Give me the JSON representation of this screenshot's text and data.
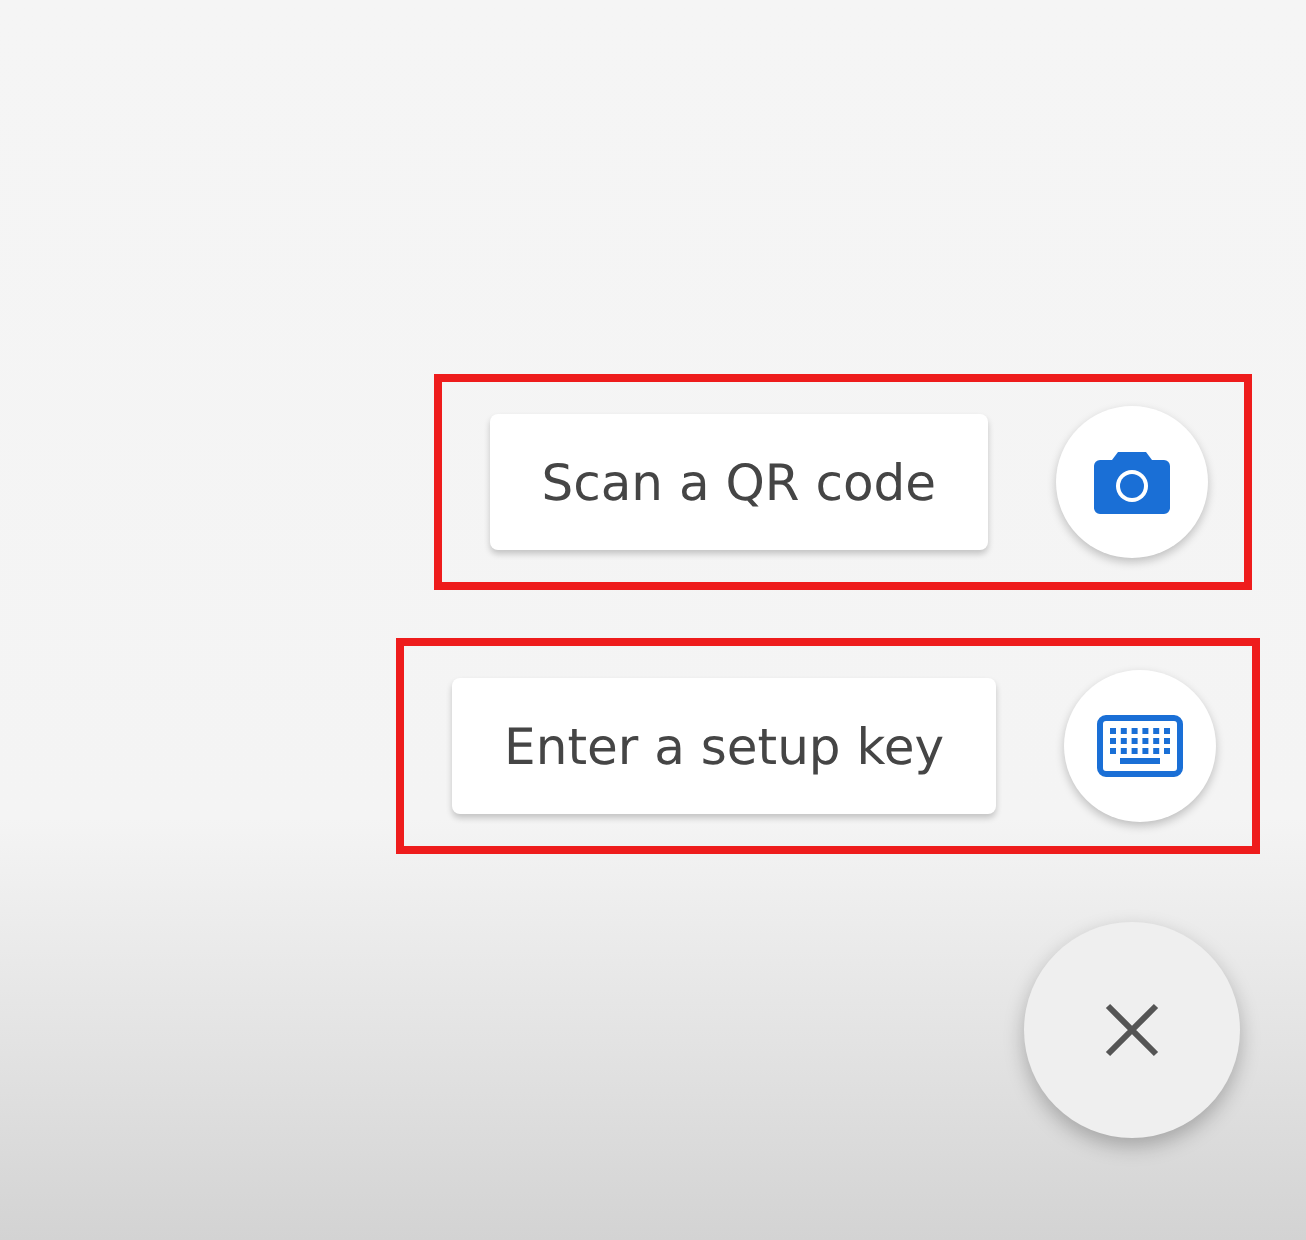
{
  "actions": [
    {
      "label": "Scan a QR code",
      "kind": "camera",
      "highlighted": true
    },
    {
      "label": "Enter a setup key",
      "kind": "keyboard",
      "highlighted": true
    }
  ],
  "close_button": {
    "kind": "close"
  }
}
